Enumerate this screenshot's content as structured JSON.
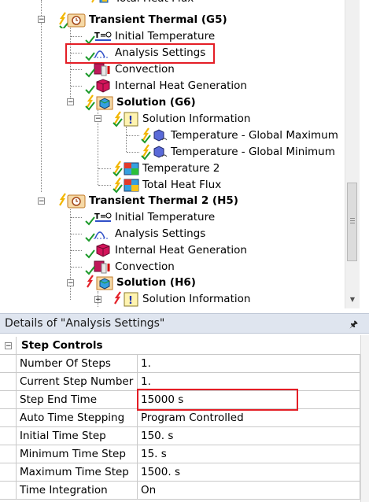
{
  "tree": {
    "nodes": [
      {
        "id": "n0",
        "label": "Total Heat Flux",
        "bold": false,
        "icon": "heat-flux-icon"
      },
      {
        "id": "n1",
        "label": "Transient Thermal (G5)",
        "bold": true,
        "icon": "transient-thermal-icon"
      },
      {
        "id": "n2",
        "label": "Initial Temperature",
        "bold": false,
        "icon": "initial-temperature-icon"
      },
      {
        "id": "n3",
        "label": "Analysis Settings",
        "bold": false,
        "icon": "analysis-settings-icon"
      },
      {
        "id": "n4",
        "label": "Convection",
        "bold": false,
        "icon": "convection-icon"
      },
      {
        "id": "n5",
        "label": "Internal Heat Generation",
        "bold": false,
        "icon": "internal-heat-generation-icon"
      },
      {
        "id": "n6",
        "label": "Solution (G6)",
        "bold": true,
        "icon": "solution-icon"
      },
      {
        "id": "n7",
        "label": "Solution Information",
        "bold": false,
        "icon": "solution-information-icon"
      },
      {
        "id": "n8",
        "label": "Temperature - Global Maximum",
        "bold": false,
        "icon": "probe-icon"
      },
      {
        "id": "n9",
        "label": "Temperature - Global Minimum",
        "bold": false,
        "icon": "probe-icon"
      },
      {
        "id": "n10",
        "label": "Temperature 2",
        "bold": false,
        "icon": "temperature-result-icon"
      },
      {
        "id": "n11",
        "label": "Total Heat Flux",
        "bold": false,
        "icon": "heat-flux-icon"
      },
      {
        "id": "n12",
        "label": "Transient Thermal 2 (H5)",
        "bold": true,
        "icon": "transient-thermal-icon"
      },
      {
        "id": "n13",
        "label": "Initial Temperature",
        "bold": false,
        "icon": "initial-temperature-icon"
      },
      {
        "id": "n14",
        "label": "Analysis Settings",
        "bold": false,
        "icon": "analysis-settings-icon"
      },
      {
        "id": "n15",
        "label": "Internal Heat Generation",
        "bold": false,
        "icon": "internal-heat-generation-icon"
      },
      {
        "id": "n16",
        "label": "Convection",
        "bold": false,
        "icon": "convection-icon"
      },
      {
        "id": "n17",
        "label": "Solution (H6)",
        "bold": true,
        "icon": "solution-icon"
      },
      {
        "id": "n18",
        "label": "Solution Information",
        "bold": false,
        "icon": "solution-information-icon"
      }
    ]
  },
  "details": {
    "title": "Details of \"Analysis Settings\"",
    "section": "Step Controls",
    "rows": [
      {
        "name": "Number Of Steps",
        "value": "1."
      },
      {
        "name": "Current Step Number",
        "value": "1."
      },
      {
        "name": "Step End Time",
        "value": "15000 s"
      },
      {
        "name": "Auto Time Stepping",
        "value": "Program Controlled"
      },
      {
        "name": "Initial Time Step",
        "value": "150. s"
      },
      {
        "name": "Minimum Time Step",
        "value": "15. s"
      },
      {
        "name": "Maximum Time Step",
        "value": "1500. s"
      },
      {
        "name": "Time Integration",
        "value": "On"
      }
    ]
  },
  "colors": {
    "highlight": "#e41e26",
    "header_bg": "#dfe5ef",
    "check_green": "#1d9a2b",
    "bolt_yellow": "#f2b600"
  }
}
